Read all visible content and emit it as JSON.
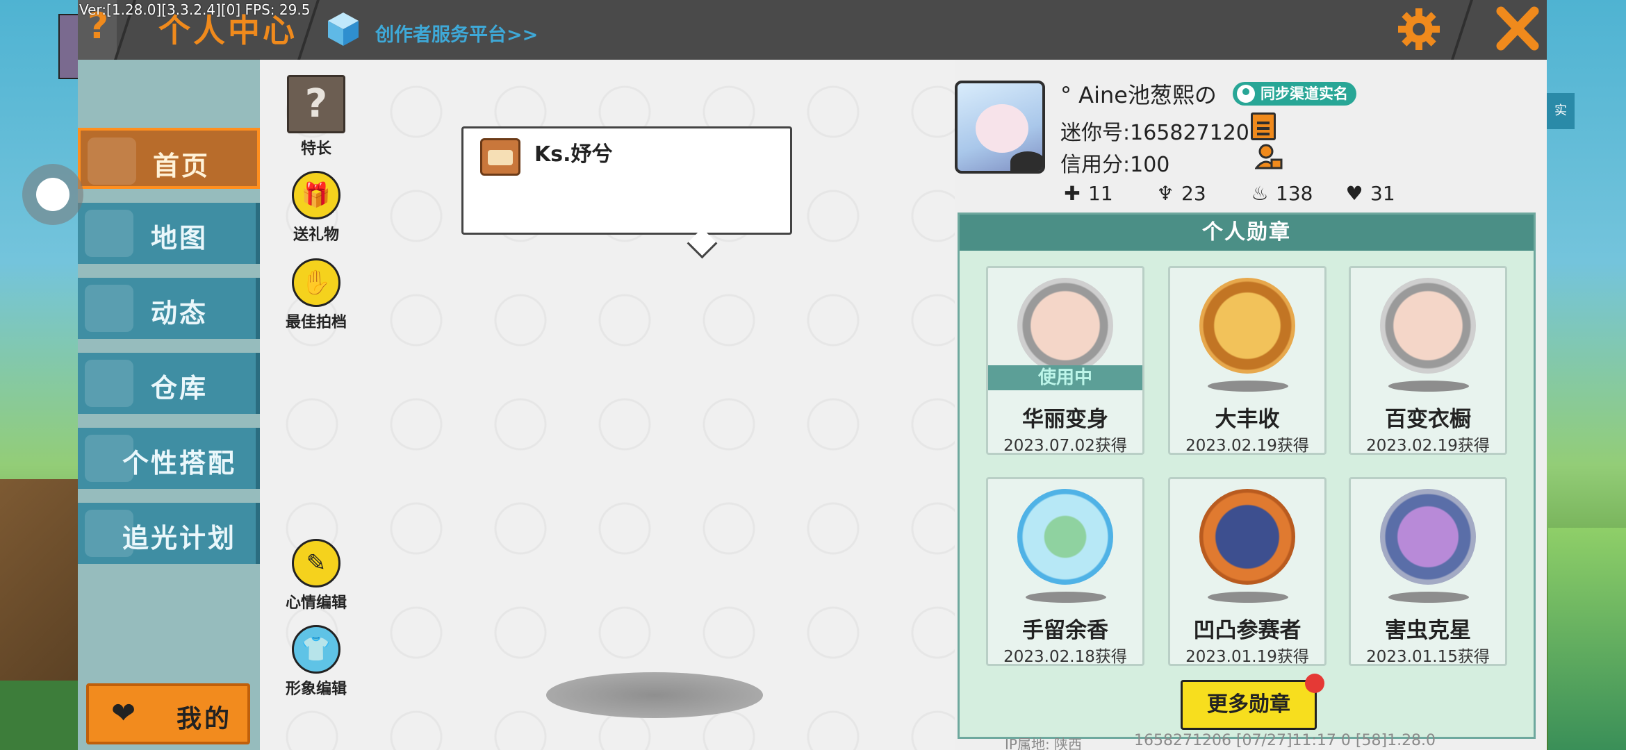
{
  "overlay": {
    "version": "Ver:[1.28.0][3.3.2.4][0] FPS: 29.5"
  },
  "background": {
    "right_tag": "实"
  },
  "topbar": {
    "help_mark": "?",
    "title": "个人中心",
    "creator_link": "创作者服务平台>>",
    "accent_color": "#f08a1c"
  },
  "sidebar": {
    "items": [
      {
        "label": "首页",
        "icon": "home-icon",
        "active": true
      },
      {
        "label": "地图",
        "icon": "map-icon",
        "active": false
      },
      {
        "label": "动态",
        "icon": "bell-icon",
        "active": false
      },
      {
        "label": "仓库",
        "icon": "house-icon",
        "active": false
      },
      {
        "label": "个性搭配",
        "icon": "outfit-icon",
        "active": false
      },
      {
        "label": "追光计划",
        "icon": "light-icon",
        "active": false
      }
    ],
    "mine_button": "我的"
  },
  "tools": {
    "specialty": "特长",
    "specialty_mark": "?",
    "gift": "送礼物",
    "best_photo": "最佳拍档",
    "mood_edit": "心情编辑",
    "avatar_edit": "形象编辑"
  },
  "bubble": {
    "name": "Ks.妤兮"
  },
  "profile": {
    "name": "° Aine池葱熙の",
    "sync_badge": "同步渠道实名",
    "mini_id": "迷你号:1658271206",
    "credit": "信用分:100",
    "stats": {
      "a": "11",
      "b": "23",
      "c": "138",
      "d": "31"
    }
  },
  "medals": {
    "header": "个人勋章",
    "in_use_label": "使用中",
    "items": [
      {
        "name": "华丽变身",
        "date": "2023.07.02获得"
      },
      {
        "name": "大丰收",
        "date": "2023.02.19获得"
      },
      {
        "name": "百变衣橱",
        "date": "2023.02.19获得"
      },
      {
        "name": "手留余香",
        "date": "2023.02.18获得"
      },
      {
        "name": "凹凸参赛者",
        "date": "2023.01.19获得"
      },
      {
        "name": "害虫克星",
        "date": "2023.01.15获得"
      }
    ],
    "more_button": "更多勋章"
  },
  "footer": {
    "ip": "IP属地: 陕西",
    "info": "1658271206   [07/27]11:17 0  [58]1.28.0"
  }
}
